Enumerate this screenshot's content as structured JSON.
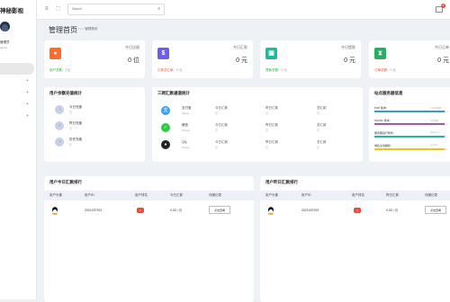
{
  "sidebar": {
    "brand": "神秘影视",
    "admin_name": "管理员",
    "admin_sub": "admin"
  },
  "topbar": {
    "search_placeholder": "Search",
    "notif_count": "0"
  },
  "page": {
    "title": "管理首页",
    "breadcrumb": "管理首页"
  },
  "stats": [
    {
      "label": "今日注册",
      "value": "0 位",
      "icon_color": "#ff6b2b",
      "icon": "person-icon",
      "foot_label": "用户总数：",
      "foot_value": "1位",
      "foot_color": "#28a745"
    },
    {
      "label": "今日汇款",
      "value": "0 元",
      "icon_color": "#6c5ce7",
      "icon": "dollar-icon",
      "foot_label": "汇款总汇款：",
      "foot_value": "0 元",
      "foot_color": "#e74c3c"
    },
    {
      "label": "今日提款",
      "value": "0 元",
      "icon_color": "#1abc9c",
      "icon": "wallet-icon",
      "foot_label": "提款总额：",
      "foot_value": "0 元",
      "foot_color": "#28a745"
    },
    {
      "label": "今日订单",
      "value": "0 元",
      "icon_color": "#27ae60",
      "icon": "hourglass-icon",
      "foot_label": "订单总额：",
      "foot_value": "0 元",
      "foot_color": "#e74c3c"
    }
  ],
  "user_recharge": {
    "title": "用户余额充值统计",
    "items": [
      {
        "name": "今日充值",
        "value": "元"
      },
      {
        "name": "昨日充值",
        "value": "元"
      },
      {
        "name": "历史充值",
        "value": "元"
      }
    ]
  },
  "channel": {
    "title": "三网汇款通道统计",
    "headers": [
      "今日汇款",
      "昨日汇款",
      "总汇款"
    ],
    "rows": [
      {
        "name": "支付宝",
        "sub": "Alipay",
        "icon": "alipay-icon",
        "color": "#3da3f5",
        "values": [
          "元",
          "元",
          "元"
        ]
      },
      {
        "name": "微信",
        "sub": "Wxpay",
        "icon": "wechat-icon",
        "color": "#2ecc40",
        "values": [
          "元",
          "元",
          "元"
        ]
      },
      {
        "name": "QQ",
        "sub": "Qqpay",
        "icon": "qq-icon",
        "color": "#222222",
        "values": [
          "元",
          "元",
          "元"
        ]
      }
    ]
  },
  "site": {
    "title": "站点服务器信息",
    "items": [
      {
        "label": "PHP 版本：",
        "value": "7.4.33 版本",
        "color": "#3498db",
        "level": 0.95
      },
      {
        "label": "MySQL 版本：",
        "value": "5.6 版本",
        "color": "#9b59b6",
        "level": 0.95
      },
      {
        "label": "服务器运行软件：",
        "value": "nginx 1.x",
        "color": "#1abc9c",
        "level": 0.95
      },
      {
        "label": "域名主动解析：",
        "value": "xx.com",
        "color": "#f1c40f",
        "level": 0.95
      }
    ]
  },
  "rank_today": {
    "title": "用户今日汇款排行",
    "headers": [
      "用户头像",
      "用户ID",
      "用户排名",
      "今日汇款",
      "详细记录"
    ],
    "row": {
      "uid": "2021037921",
      "rank": "1",
      "amount": "0.00 / 元",
      "button": "点击查看"
    }
  },
  "rank_yesterday": {
    "title": "用户昨日汇款排行",
    "headers": [
      "用户头像",
      "用户ID",
      "用户排名",
      "昨日汇款",
      "详细记录"
    ],
    "row": {
      "uid": "2021037921",
      "rank": "1",
      "amount": "0.00 / 元",
      "button": "点击查看"
    }
  }
}
